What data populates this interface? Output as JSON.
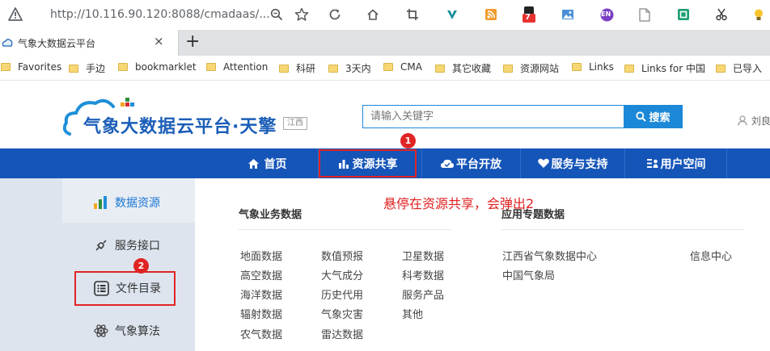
{
  "browser": {
    "url": "http://10.116.90.120:8088/cmadaas/...",
    "tab_title": "气象大数据云平台",
    "tab_close": "×",
    "new_tab": "+",
    "ext_badge": "7",
    "ext_en": "EN",
    "bookmarks": [
      "Favorites",
      "手边",
      "bookmarklet",
      "Attention",
      "科研",
      "3天内",
      "CMA",
      "其它收藏",
      "资源网站",
      "Links",
      "Links for 中国",
      "已导入"
    ]
  },
  "header": {
    "logo_text": "气象大数据云平台·天擎",
    "region": "江西",
    "search_placeholder": "请输入关键字",
    "search_label": "搜索",
    "user_name": "刘良"
  },
  "nav": {
    "items": [
      "首页",
      "资源共享",
      "平台开放",
      "服务与支持",
      "用户空间"
    ]
  },
  "sidebar": {
    "items": [
      "数据资源",
      "服务接口",
      "文件目录",
      "气象算法"
    ]
  },
  "content": {
    "left_heading": "气象业务数据",
    "right_heading": "应用专题数据",
    "col1": [
      "地面数据",
      "高空数据",
      "海洋数据",
      "辐射数据",
      "农气数据"
    ],
    "col2": [
      "数值预报",
      "大气成分",
      "历史代用",
      "气象灾害",
      "雷达数据"
    ],
    "col3": [
      "卫星数据",
      "科考数据",
      "服务产品",
      "其他"
    ],
    "col4": [
      "江西省气象数据中心",
      "中国气象局"
    ],
    "col5": [
      "信息中心"
    ]
  },
  "annotations": {
    "note": "悬停在资源共享，会弹出2",
    "badge1": "1",
    "badge2": "2"
  },
  "colors": {
    "nav_blue": "#1555b8",
    "accent_blue": "#1c88d8",
    "annotation_red": "#e02424"
  }
}
